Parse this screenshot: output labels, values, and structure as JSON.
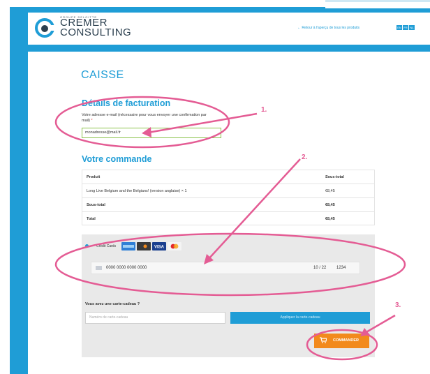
{
  "header": {
    "logo_small": "GROUPE DELOITTE",
    "logo_line1": "CREMER",
    "logo_line2": "CONSULTING",
    "back_link": "← Retour à l'aperçu de tous les produits",
    "languages": [
      "EN",
      "FR",
      "NL"
    ]
  },
  "checkout": {
    "title": "CAISSE",
    "billing_title": "Détails de facturation",
    "email_label": "Votre adresse e-mail (nécessaire pour vous envoyer une confirmation par mail)",
    "email_required": "*",
    "email_value": "monadresse@mail.fr",
    "order_title": "Votre commande",
    "table": {
      "col_product": "Produit",
      "col_subtotal": "Sous-total",
      "rows": [
        {
          "product": "Long Live Belgium and the Belgians! (version anglaise)  × 1",
          "amount": "€8,45"
        },
        {
          "product": "Sous-total",
          "amount": "€8,45"
        },
        {
          "product": "Total",
          "amount": "€8,45"
        }
      ]
    },
    "payment": {
      "method_label": "Credit Cards",
      "card_brands": [
        "amex",
        "discover",
        "VISA",
        "mastercard"
      ],
      "card_number": "0000 0000 0000 0000",
      "expiry": "10 / 22",
      "cvc": "1234"
    },
    "gift": {
      "question": "Vous avez une carte-cadeau ?",
      "placeholder": "Numéro de carte-cadeau",
      "apply_label": "Appliquer la carte-cadeau"
    },
    "order_button": "COMMANDER"
  },
  "annotations": {
    "label_1": "1.",
    "label_2": "2.",
    "label_3": "3.",
    "color": "#e45c94"
  },
  "colors": {
    "brand_blue": "#1f9dd6",
    "order_orange": "#f28a1c",
    "panel_gray": "#e9e9e9"
  }
}
